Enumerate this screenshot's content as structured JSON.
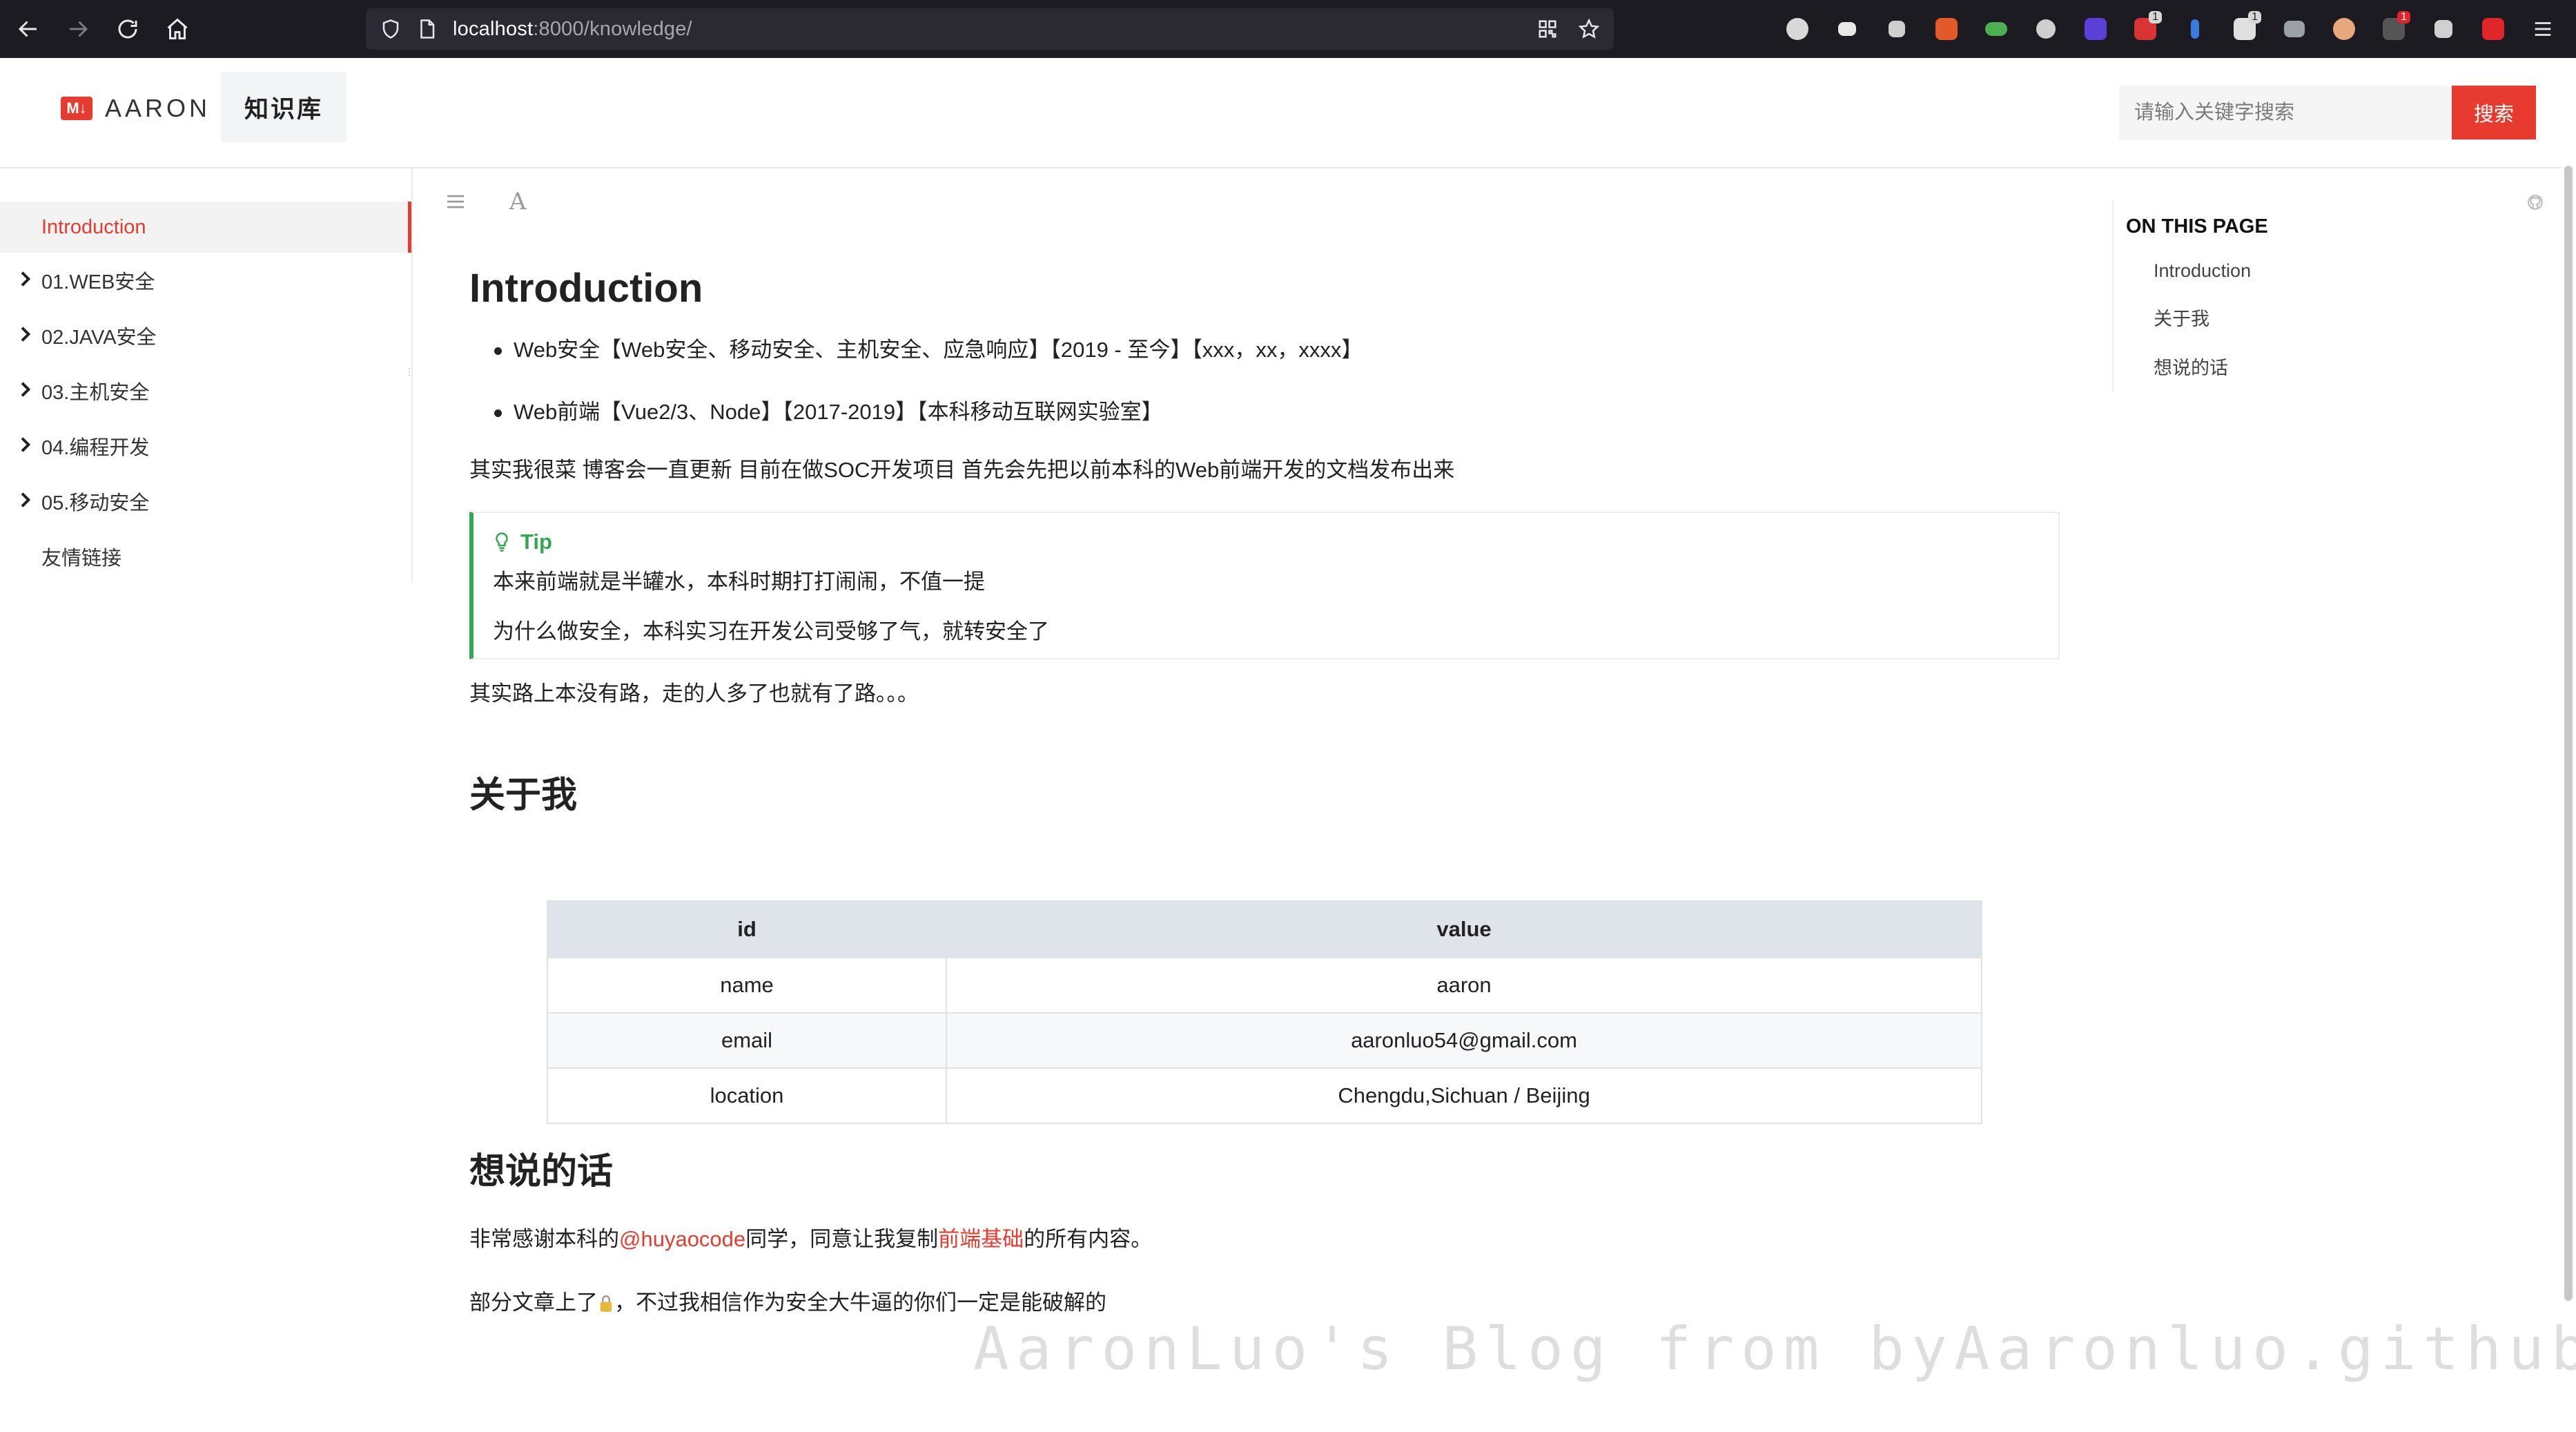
{
  "browser": {
    "url_host": "localhost",
    "url_rest": ":8000/knowledge/"
  },
  "header": {
    "logo_badge": "M↓",
    "logo_text": "AARON",
    "nav_tab": "知识库",
    "search_placeholder": "请输入关键字搜索",
    "search_button": "搜索"
  },
  "sidebar": {
    "items": [
      {
        "label": "Introduction",
        "active": true,
        "expandable": false
      },
      {
        "label": "01.WEB安全",
        "expandable": true
      },
      {
        "label": "02.JAVA安全",
        "expandable": true
      },
      {
        "label": "03.主机安全",
        "expandable": true
      },
      {
        "label": "04.编程开发",
        "expandable": true
      },
      {
        "label": "05.移动安全",
        "expandable": true
      },
      {
        "label": "友情链接",
        "expandable": false
      }
    ]
  },
  "content": {
    "title": "Introduction",
    "bullets": [
      "Web安全【Web安全、移动安全、主机安全、应急响应】【2019 - 至今】【xxx，xx，xxxx】",
      "Web前端【Vue2/3、Node】【2017-2019】【本科移动互联网实验室】"
    ],
    "intro_para": "其实我很菜 博客会一直更新 目前在做SOC开发项目 首先会先把以前本科的Web前端开发的文档发布出来",
    "tip": {
      "title": "Tip",
      "lines": [
        "本来前端就是半罐水，本科时期打打闹闹，不值一提",
        "为什么做安全，本科实习在开发公司受够了气，就转安全了"
      ]
    },
    "road_para": "其实路上本没有路，走的人多了也就有了路。。。",
    "about_heading": "关于我",
    "table": {
      "headers": [
        "id",
        "value"
      ],
      "rows": [
        [
          "name",
          "aaron"
        ],
        [
          "email",
          "aaronluo54@gmail.com"
        ],
        [
          "location",
          "Chengdu,Sichuan / Beijing"
        ]
      ]
    },
    "words_heading": "想说的话",
    "thanks": {
      "prefix": "非常感谢本科的",
      "user_link": "@huyaocode",
      "middle": "同学，同意让我复制",
      "page_link": "前端基础",
      "suffix": "的所有内容。"
    },
    "lock_line": {
      "prefix": "部分文章上了",
      "suffix": "，不过我相信作为安全大牛逼的你们一定是能破解的"
    }
  },
  "toc": {
    "title": "ON THIS PAGE",
    "items": [
      "Introduction",
      "关于我",
      "想说的话"
    ]
  },
  "watermark": "AaronLuo's Blog from byAaronluo.github.io",
  "colors": {
    "accent": "#e63b2e",
    "tip_green": "#33a852",
    "chrome_bg": "#1c1b22"
  }
}
